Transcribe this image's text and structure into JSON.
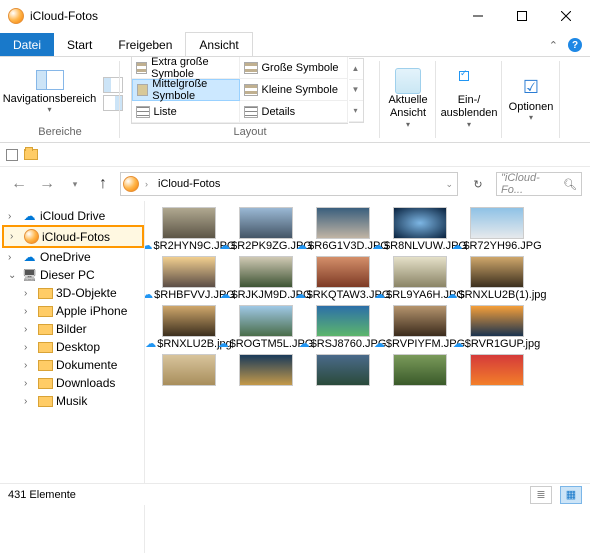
{
  "window": {
    "title": "iCloud-Fotos"
  },
  "tabs": {
    "file": "Datei",
    "start": "Start",
    "share": "Freigeben",
    "view": "Ansicht"
  },
  "ribbon": {
    "groups": {
      "panes": "Bereiche",
      "layout": "Layout"
    },
    "navpane": "Navigationsbereich",
    "layouts": {
      "xl": "Extra große Symbole",
      "large": "Große Symbole",
      "medium": "Mittelgroße Symbole",
      "small": "Kleine Symbole",
      "list": "Liste",
      "details": "Details"
    },
    "currentview": "Aktuelle\nAnsicht",
    "showhide": "Ein-/\nausblenden",
    "options": "Optionen"
  },
  "nav": {
    "location": "iCloud-Fotos",
    "searchPlaceholder": "\"iCloud-Fo..."
  },
  "tree": {
    "items": [
      {
        "label": "iCloud Drive",
        "level": 1,
        "icon": "cloud",
        "expand": "›"
      },
      {
        "label": "iCloud-Fotos",
        "level": 1,
        "icon": "cloud-photos",
        "expand": "›",
        "selected": true
      },
      {
        "label": "OneDrive",
        "level": 1,
        "icon": "cloud",
        "expand": "›"
      },
      {
        "label": "Dieser PC",
        "level": 1,
        "icon": "pc",
        "expand": "⌄"
      },
      {
        "label": "3D-Objekte",
        "level": 2,
        "icon": "folder",
        "expand": "›"
      },
      {
        "label": "Apple iPhone",
        "level": 2,
        "icon": "folder",
        "expand": "›"
      },
      {
        "label": "Bilder",
        "level": 2,
        "icon": "folder",
        "expand": "›"
      },
      {
        "label": "Desktop",
        "level": 2,
        "icon": "folder",
        "expand": "›"
      },
      {
        "label": "Dokumente",
        "level": 2,
        "icon": "folder",
        "expand": "›"
      },
      {
        "label": "Downloads",
        "level": 2,
        "icon": "folder",
        "expand": "›"
      },
      {
        "label": "Musik",
        "level": 2,
        "icon": "folder",
        "expand": "›"
      }
    ]
  },
  "files": [
    {
      "name": "$R2HYN9C.JPG",
      "bg": "linear-gradient(#b0a890,#5c5546)"
    },
    {
      "name": "$R2PK9ZG.JPG",
      "bg": "linear-gradient(#9ab8d4,#456)"
    },
    {
      "name": "$R6G1V3D.JPG",
      "bg": "linear-gradient(#3a5f7d,#c0b4a4)"
    },
    {
      "name": "$R8NLVUW.JPG",
      "bg": "radial-gradient(#7db6e4,#08213d)"
    },
    {
      "name": "$R72YH96.JPG",
      "bg": "linear-gradient(#8fc2e6,#e6e9ec)"
    },
    {
      "name": "$RHBFVVJ.JPG",
      "bg": "linear-gradient(#f2cf8f,#5b4d46)"
    },
    {
      "name": "$RJKJM9D.JPG",
      "bg": "linear-gradient(#d0c9b4,#3e5434)"
    },
    {
      "name": "$RKQTAW3.JPG",
      "bg": "linear-gradient(#d48f6a,#7d3a25)"
    },
    {
      "name": "$RL9YA6H.JPG",
      "bg": "linear-gradient(#e4e0c8,#8a8466)"
    },
    {
      "name": "$RNXLU2B(1).jpg",
      "bg": "linear-gradient(#cfa76b,#3c2f1e)"
    },
    {
      "name": "$RNXLU2B.jpg",
      "bg": "linear-gradient(#cfa76b,#3c2f1e)"
    },
    {
      "name": "$ROGTM5L.JPG",
      "bg": "linear-gradient(#9fc8e6,#4a6d4a)"
    },
    {
      "name": "$RSJ8760.JPG",
      "bg": "linear-gradient(#2c6fa8,#5db66c)"
    },
    {
      "name": "$RVPIYFM.JPG",
      "bg": "linear-gradient(#b5946d,#3b2b1c)"
    },
    {
      "name": "$RVR1GUP.jpg",
      "bg": "linear-gradient(#f59f3a,#1a334f)"
    },
    {
      "name": "",
      "bg": "linear-gradient(#d8c49c,#a88e5c)"
    },
    {
      "name": "",
      "bg": "linear-gradient(#1a3a5a,#c49a4a)"
    },
    {
      "name": "",
      "bg": "linear-gradient(#4a6a8a,#2a4a3a)"
    },
    {
      "name": "",
      "bg": "linear-gradient(#7a9a5a,#3a5a2a)"
    },
    {
      "name": "",
      "bg": "linear-gradient(#d43a3a,#f27f2a)"
    }
  ],
  "status": {
    "count": "431 Elemente"
  }
}
